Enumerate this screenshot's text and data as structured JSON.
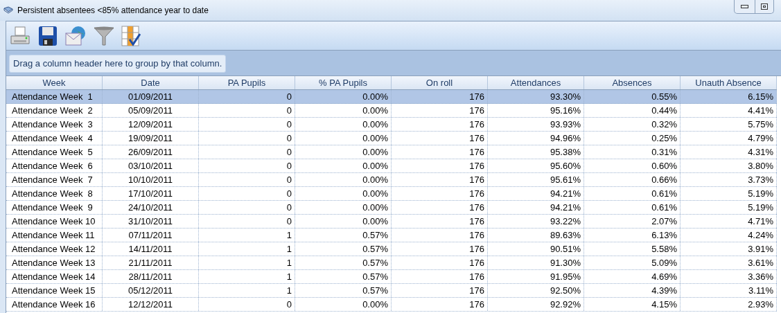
{
  "window": {
    "title": "Persistent absentees <85% attendance year to date"
  },
  "group_panel": {
    "hint": "Drag a column header here to group by that column."
  },
  "table": {
    "columns": [
      "Week",
      "Date",
      "PA Pupils",
      "% PA Pupils",
      "On roll",
      "Attendances",
      "Absences",
      "Unauth Absence"
    ],
    "rows": [
      {
        "selected": true,
        "cells": [
          "Attendance Week  1",
          "01/09/2011",
          "0",
          "0.00%",
          "176",
          "93.30%",
          "0.55%",
          "6.15%"
        ]
      },
      {
        "selected": false,
        "cells": [
          "Attendance Week  2",
          "05/09/2011",
          "0",
          "0.00%",
          "176",
          "95.16%",
          "0.44%",
          "4.41%"
        ]
      },
      {
        "selected": false,
        "cells": [
          "Attendance Week  3",
          "12/09/2011",
          "0",
          "0.00%",
          "176",
          "93.93%",
          "0.32%",
          "5.75%"
        ]
      },
      {
        "selected": false,
        "cells": [
          "Attendance Week  4",
          "19/09/2011",
          "0",
          "0.00%",
          "176",
          "94.96%",
          "0.25%",
          "4.79%"
        ]
      },
      {
        "selected": false,
        "cells": [
          "Attendance Week  5",
          "26/09/2011",
          "0",
          "0.00%",
          "176",
          "95.38%",
          "0.31%",
          "4.31%"
        ]
      },
      {
        "selected": false,
        "cells": [
          "Attendance Week  6",
          "03/10/2011",
          "0",
          "0.00%",
          "176",
          "95.60%",
          "0.60%",
          "3.80%"
        ]
      },
      {
        "selected": false,
        "cells": [
          "Attendance Week  7",
          "10/10/2011",
          "0",
          "0.00%",
          "176",
          "95.61%",
          "0.66%",
          "3.73%"
        ]
      },
      {
        "selected": false,
        "cells": [
          "Attendance Week  8",
          "17/10/2011",
          "0",
          "0.00%",
          "176",
          "94.21%",
          "0.61%",
          "5.19%"
        ]
      },
      {
        "selected": false,
        "cells": [
          "Attendance Week  9",
          "24/10/2011",
          "0",
          "0.00%",
          "176",
          "94.21%",
          "0.61%",
          "5.19%"
        ]
      },
      {
        "selected": false,
        "cells": [
          "Attendance Week 10",
          "31/10/2011",
          "0",
          "0.00%",
          "176",
          "93.22%",
          "2.07%",
          "4.71%"
        ]
      },
      {
        "selected": false,
        "cells": [
          "Attendance Week 11",
          "07/11/2011",
          "1",
          "0.57%",
          "176",
          "89.63%",
          "6.13%",
          "4.24%"
        ]
      },
      {
        "selected": false,
        "cells": [
          "Attendance Week 12",
          "14/11/2011",
          "1",
          "0.57%",
          "176",
          "90.51%",
          "5.58%",
          "3.91%"
        ]
      },
      {
        "selected": false,
        "cells": [
          "Attendance Week 13",
          "21/11/2011",
          "1",
          "0.57%",
          "176",
          "91.30%",
          "5.09%",
          "3.61%"
        ]
      },
      {
        "selected": false,
        "cells": [
          "Attendance Week 14",
          "28/11/2011",
          "1",
          "0.57%",
          "176",
          "91.95%",
          "4.69%",
          "3.36%"
        ]
      },
      {
        "selected": false,
        "cells": [
          "Attendance Week 15",
          "05/12/2011",
          "1",
          "0.57%",
          "176",
          "92.50%",
          "4.39%",
          "3.11%"
        ]
      },
      {
        "selected": false,
        "cells": [
          "Attendance Week 16",
          "12/12/2011",
          "0",
          "0.00%",
          "176",
          "92.92%",
          "4.15%",
          "2.93%"
        ]
      }
    ]
  }
}
